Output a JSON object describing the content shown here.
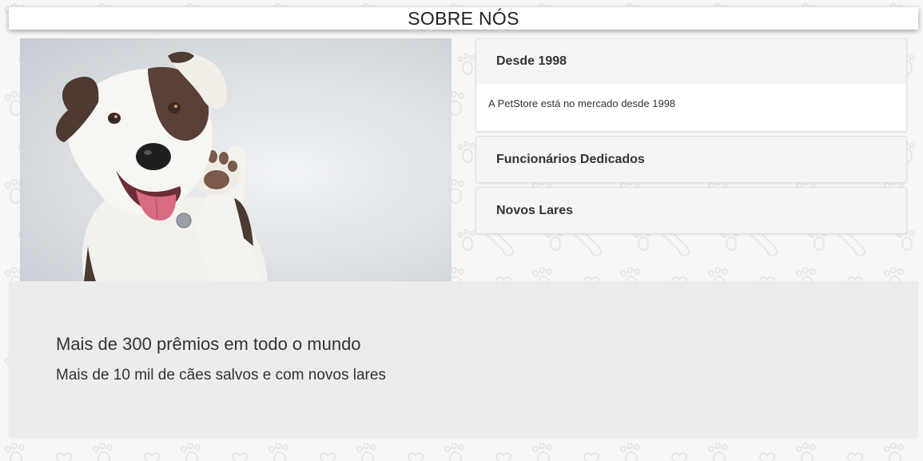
{
  "page": {
    "title": "SOBRE NÓS",
    "photo_alt": "cachorro acenando"
  },
  "accordion": [
    {
      "header": "Desde 1998",
      "body": "A PetStore está no mercado desde 1998",
      "expanded": true
    },
    {
      "header": "Funcionários Dedicados",
      "expanded": false
    },
    {
      "header": "Novos Lares",
      "expanded": false
    }
  ],
  "stats": {
    "line1": "Mais de 300 prêmios em todo o mundo",
    "line2": "Mais de 10 mil de cães salvos e com novos lares"
  },
  "colors": {
    "background": "#f7f7f7",
    "panel": "#ececec",
    "header_bg": "#f5f5f5",
    "text": "#333333"
  }
}
